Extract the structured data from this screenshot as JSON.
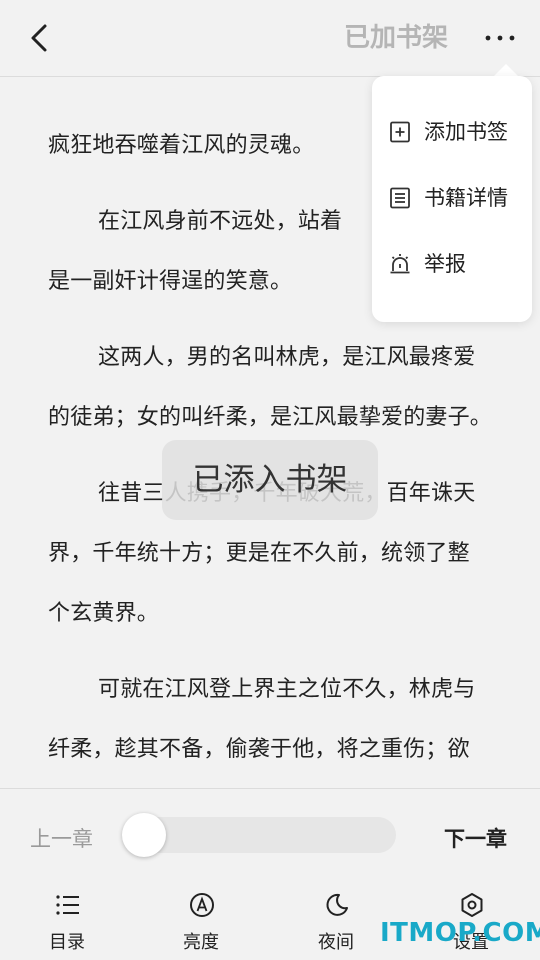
{
  "header": {
    "shelf_status": "已加书架"
  },
  "menu": {
    "items": [
      {
        "label": "添加书签",
        "icon": "bookmark-add-icon"
      },
      {
        "label": "书籍详情",
        "icon": "book-details-icon"
      },
      {
        "label": "举报",
        "icon": "report-alarm-icon"
      }
    ]
  },
  "content": {
    "paragraphs": [
      "疯狂地吞噬着江风的灵魂。",
      "在江风身前不远处，站着",
      "是一副奸计得逞的笑意。",
      "这两人，男的名叫林虎，是江风最疼爱",
      "的徒弟；女的叫纤柔，是江风最挚爱的妻子。",
      "往昔三人携手，千年破大荒，百年诛天",
      "界，千年统十方；更是在不久前，统领了整",
      "个玄黄界。",
      "可就在江风登上界主之位不久，林虎与",
      "纤柔，趁其不备，偷袭于他，将之重伤；欲"
    ]
  },
  "toast": {
    "message": "已添入书架"
  },
  "chapter_nav": {
    "prev_label": "上一章",
    "next_label": "下一章",
    "progress": 0
  },
  "bottom_nav": {
    "items": [
      {
        "label": "目录",
        "icon": "list-icon"
      },
      {
        "label": "亮度",
        "icon": "brightness-icon"
      },
      {
        "label": "夜间",
        "icon": "moon-icon"
      },
      {
        "label": "设置",
        "icon": "settings-icon"
      }
    ]
  },
  "watermark": {
    "text": "ITMOP.COM"
  },
  "colors": {
    "background": "#f2f2f2",
    "watermark": "#19a9c8"
  }
}
